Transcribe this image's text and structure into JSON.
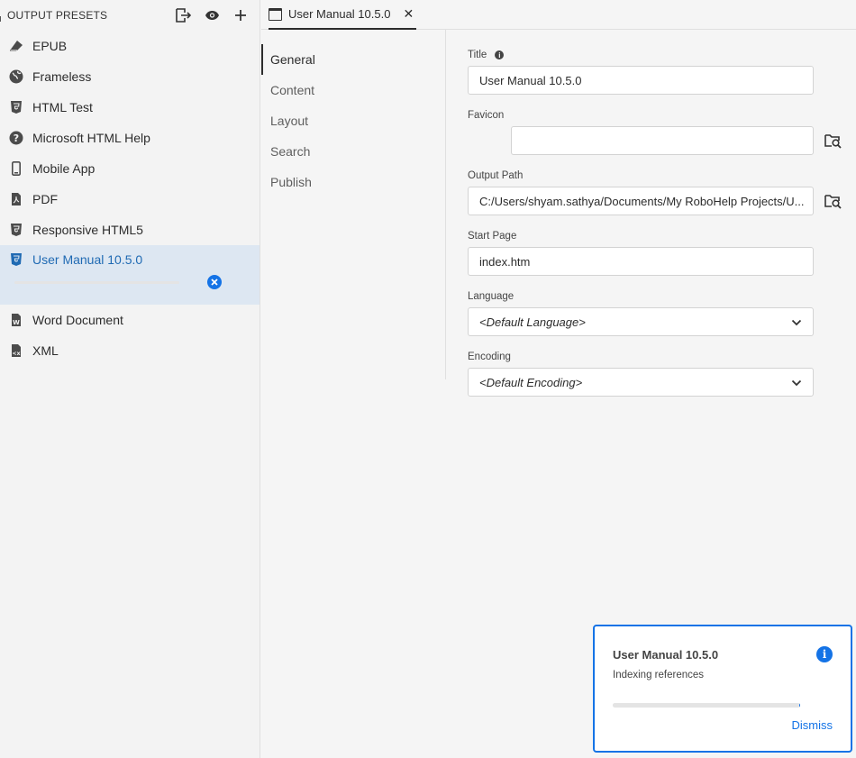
{
  "left_panel": {
    "title": "OUTPUT PRESETS",
    "icons": [
      "export-icon",
      "eye-icon",
      "plus-icon"
    ],
    "presets": [
      {
        "label": "EPUB",
        "icon": "epub-icon"
      },
      {
        "label": "Frameless",
        "icon": "globe-icon"
      },
      {
        "label": "HTML Test",
        "icon": "html5-icon"
      },
      {
        "label": "Microsoft HTML Help",
        "icon": "help-circle-icon"
      },
      {
        "label": "Mobile App",
        "icon": "mobile-icon"
      },
      {
        "label": "PDF",
        "icon": "pdf-file-icon"
      },
      {
        "label": "Responsive HTML5",
        "icon": "html5-icon"
      },
      {
        "label": "User Manual 10.5.0",
        "icon": "html5-icon",
        "selected": true,
        "progress": 0
      },
      {
        "label": "Word Document",
        "icon": "word-file-icon"
      },
      {
        "label": "XML",
        "icon": "xml-file-icon"
      }
    ]
  },
  "tab": {
    "label": "User Manual 10.5.0",
    "close": "✕"
  },
  "nav": {
    "items": [
      "General",
      "Content",
      "Layout",
      "Search",
      "Publish"
    ],
    "active": "General"
  },
  "form": {
    "title_label": "Title",
    "title_value": "User Manual 10.5.0",
    "favicon_label": "Favicon",
    "favicon_value": "",
    "output_path_label": "Output Path",
    "output_path_value": "C:/Users/shyam.sathya/Documents/My RoboHelp Projects/U...",
    "start_page_label": "Start Page",
    "start_page_value": "index.htm",
    "language_label": "Language",
    "language_value": "<Default Language>",
    "encoding_label": "Encoding",
    "encoding_value": "<Default Encoding>"
  },
  "toast": {
    "title": "User Manual 10.5.0",
    "message": "Indexing references",
    "dismiss": "Dismiss",
    "progress": 0.99
  },
  "colors": {
    "accent": "#1473e6",
    "selected_bg": "#dde7f2",
    "selected_text": "#1f6ab3"
  }
}
